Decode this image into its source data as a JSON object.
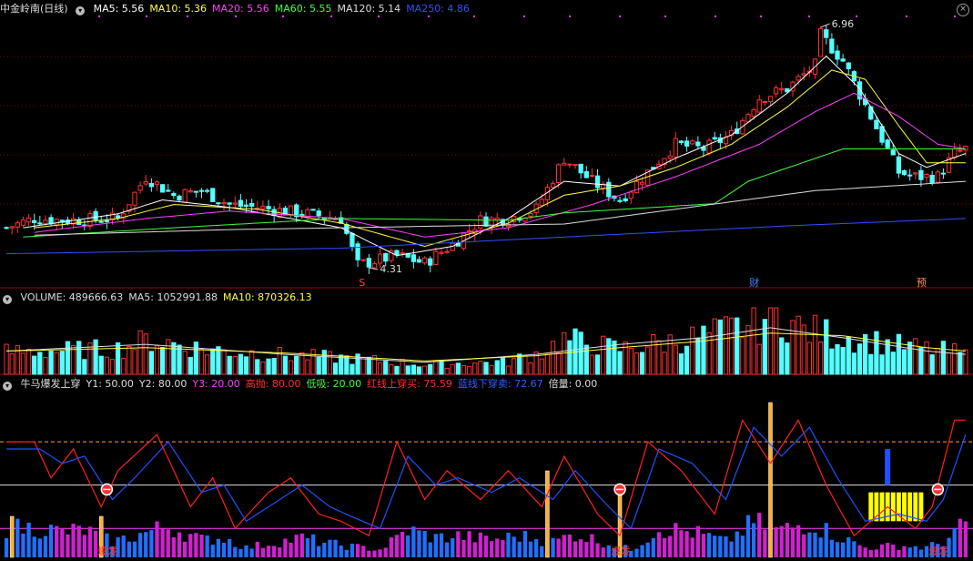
{
  "price_panel": {
    "stock_title": "中金岭南(日线)",
    "indicators": [
      {
        "label": "MA5: 5.56",
        "color": "#ffffff"
      },
      {
        "label": "MA10: 5.36",
        "color": "#ffff40"
      },
      {
        "label": "MA20: 5.56",
        "color": "#ff40ff"
      },
      {
        "label": "MA60: 5.55",
        "color": "#40ff40"
      },
      {
        "label": "MA120: 5.14",
        "color": "#dddddd"
      },
      {
        "label": "MA250: 4.86",
        "color": "#3050ff"
      }
    ],
    "high_label": "6.96",
    "low_label": "4.31",
    "markers": [
      {
        "label": "S",
        "color": "#ff4040"
      },
      {
        "label": "财",
        "color": "#4080ff"
      },
      {
        "label": "预",
        "color": "#ff9040"
      }
    ]
  },
  "volume_panel": {
    "indicators": [
      {
        "label": "VOLUME: 489666.63",
        "color": "#dddddd"
      },
      {
        "label": "MA5: 1052991.88",
        "color": "#dddddd"
      },
      {
        "label": "MA10: 870326.13",
        "color": "#ffff40"
      }
    ]
  },
  "osc_panel": {
    "indicators": [
      {
        "label": "牛马爆发上穿",
        "color": "#dddddd"
      },
      {
        "label": "Y1: 50.00",
        "color": "#dddddd"
      },
      {
        "label": "Y2: 80.00",
        "color": "#dddddd"
      },
      {
        "label": "Y3: 20.00",
        "color": "#ff40ff"
      },
      {
        "label": "高抛: 80.00",
        "color": "#ff3030"
      },
      {
        "label": "低吸: 20.00",
        "color": "#40ff40"
      },
      {
        "label": "红线上穿买: 75.59",
        "color": "#ff3030"
      },
      {
        "label": "蓝线下穿卖: 72.67",
        "color": "#3060ff"
      },
      {
        "label": "倍量: 0.00",
        "color": "#dddddd"
      }
    ],
    "burst_label": "爆发"
  },
  "colors": {
    "up": "#ff3030",
    "down": "#54ffff",
    "osc_red": "#ff2020",
    "osc_blue": "#2050ff",
    "bar_magenta": "#d020d0",
    "bar_blue": "#2070ff",
    "bar_orange": "#ffb030",
    "bar_yellow": "#ffff00"
  },
  "chart_data": [
    {
      "type": "candlestick",
      "n_days": 173,
      "ylim": [
        4.31,
        6.96
      ],
      "price_path": [
        [
          0,
          4.8
        ],
        [
          5,
          4.9
        ],
        [
          10,
          4.88
        ],
        [
          20,
          4.9
        ],
        [
          25,
          5.35
        ],
        [
          30,
          5.15
        ],
        [
          35,
          5.2
        ],
        [
          40,
          5.05
        ],
        [
          45,
          5.02
        ],
        [
          50,
          4.98
        ],
        [
          60,
          4.9
        ],
        [
          63,
          4.4
        ],
        [
          70,
          4.5
        ],
        [
          75,
          4.42
        ],
        [
          80,
          4.62
        ],
        [
          85,
          4.88
        ],
        [
          90,
          4.9
        ],
        [
          95,
          5.0
        ],
        [
          100,
          5.55
        ],
        [
          105,
          5.3
        ],
        [
          110,
          5.1
        ],
        [
          115,
          5.4
        ],
        [
          120,
          5.7
        ],
        [
          125,
          5.65
        ],
        [
          130,
          5.8
        ],
        [
          135,
          6.2
        ],
        [
          140,
          6.3
        ],
        [
          145,
          6.55
        ],
        [
          146,
          6.88
        ],
        [
          150,
          6.6
        ],
        [
          155,
          6.0
        ],
        [
          160,
          5.4
        ],
        [
          163,
          5.35
        ],
        [
          167,
          5.35
        ],
        [
          170,
          5.6
        ],
        [
          172,
          5.65
        ]
      ],
      "ma_paths": {
        "MA5": [
          [
            3,
            4.8
          ],
          [
            20,
            4.95
          ],
          [
            28,
            5.1
          ],
          [
            40,
            5.02
          ],
          [
            60,
            4.8
          ],
          [
            70,
            4.5
          ],
          [
            80,
            4.6
          ],
          [
            90,
            4.9
          ],
          [
            100,
            5.3
          ],
          [
            110,
            5.25
          ],
          [
            120,
            5.55
          ],
          [
            130,
            5.8
          ],
          [
            140,
            6.25
          ],
          [
            147,
            6.65
          ],
          [
            153,
            6.3
          ],
          [
            160,
            5.6
          ],
          [
            165,
            5.45
          ],
          [
            172,
            5.6
          ]
        ],
        "MA10": [
          [
            5,
            4.8
          ],
          [
            20,
            4.9
          ],
          [
            30,
            5.05
          ],
          [
            45,
            5.0
          ],
          [
            60,
            4.85
          ],
          [
            75,
            4.6
          ],
          [
            90,
            4.85
          ],
          [
            100,
            5.15
          ],
          [
            110,
            5.25
          ],
          [
            120,
            5.45
          ],
          [
            130,
            5.7
          ],
          [
            140,
            6.1
          ],
          [
            148,
            6.5
          ],
          [
            154,
            6.4
          ],
          [
            160,
            5.9
          ],
          [
            165,
            5.5
          ],
          [
            172,
            5.5
          ]
        ],
        "MA20": [
          [
            5,
            4.75
          ],
          [
            25,
            4.9
          ],
          [
            40,
            4.98
          ],
          [
            60,
            4.9
          ],
          [
            75,
            4.7
          ],
          [
            90,
            4.8
          ],
          [
            105,
            5.05
          ],
          [
            120,
            5.35
          ],
          [
            135,
            5.7
          ],
          [
            145,
            6.05
          ],
          [
            152,
            6.25
          ],
          [
            160,
            6.0
          ],
          [
            167,
            5.7
          ],
          [
            172,
            5.65
          ]
        ],
        "MA60": [
          [
            3,
            4.7
          ],
          [
            30,
            4.8
          ],
          [
            60,
            4.9
          ],
          [
            90,
            4.88
          ],
          [
            100,
            4.96
          ],
          [
            127,
            5.06
          ],
          [
            133,
            5.3
          ],
          [
            150,
            5.65
          ],
          [
            160,
            5.65
          ],
          [
            172,
            5.65
          ]
        ],
        "MA120": [
          [
            5,
            4.72
          ],
          [
            40,
            4.78
          ],
          [
            80,
            4.82
          ],
          [
            100,
            4.84
          ],
          [
            145,
            5.2
          ],
          [
            172,
            5.3
          ]
        ],
        "MA250": [
          [
            0,
            4.52
          ],
          [
            60,
            4.58
          ],
          [
            100,
            4.7
          ],
          [
            140,
            4.82
          ],
          [
            172,
            4.9
          ]
        ]
      }
    },
    {
      "type": "bar",
      "title": "VOLUME",
      "volume_path": [
        [
          0,
          0.35
        ],
        [
          20,
          0.4
        ],
        [
          26,
          0.55
        ],
        [
          35,
          0.4
        ],
        [
          50,
          0.3
        ],
        [
          62,
          0.25
        ],
        [
          75,
          0.15
        ],
        [
          90,
          0.2
        ],
        [
          96,
          0.35
        ],
        [
          100,
          0.55
        ],
        [
          110,
          0.4
        ],
        [
          118,
          0.5
        ],
        [
          125,
          0.6
        ],
        [
          132,
          0.75
        ],
        [
          135,
          0.8
        ],
        [
          137,
          1.0
        ],
        [
          143,
          0.7
        ],
        [
          150,
          0.6
        ],
        [
          160,
          0.45
        ],
        [
          170,
          0.35
        ],
        [
          172,
          0.3
        ]
      ],
      "ma5_path": [
        [
          0,
          0.35
        ],
        [
          25,
          0.45
        ],
        [
          50,
          0.3
        ],
        [
          75,
          0.18
        ],
        [
          95,
          0.3
        ],
        [
          110,
          0.45
        ],
        [
          125,
          0.55
        ],
        [
          137,
          0.7
        ],
        [
          150,
          0.55
        ],
        [
          165,
          0.35
        ],
        [
          172,
          0.3
        ]
      ],
      "ma10_path": [
        [
          0,
          0.35
        ],
        [
          25,
          0.4
        ],
        [
          50,
          0.32
        ],
        [
          75,
          0.2
        ],
        [
          95,
          0.28
        ],
        [
          110,
          0.4
        ],
        [
          125,
          0.5
        ],
        [
          137,
          0.62
        ],
        [
          150,
          0.58
        ],
        [
          165,
          0.4
        ],
        [
          172,
          0.35
        ]
      ]
    },
    {
      "type": "line",
      "title": "牛马爆发上穿",
      "ylim": [
        0,
        100
      ],
      "levels": [
        80,
        50,
        20
      ],
      "red_path": [
        [
          0,
          80
        ],
        [
          5,
          80
        ],
        [
          8,
          55
        ],
        [
          12,
          75
        ],
        [
          17,
          35
        ],
        [
          20,
          60
        ],
        [
          27,
          85
        ],
        [
          33,
          35
        ],
        [
          37,
          55
        ],
        [
          41,
          20
        ],
        [
          47,
          45
        ],
        [
          51,
          55
        ],
        [
          56,
          30
        ],
        [
          60,
          25
        ],
        [
          65,
          15
        ],
        [
          70,
          80
        ],
        [
          75,
          40
        ],
        [
          79,
          60
        ],
        [
          85,
          40
        ],
        [
          90,
          60
        ],
        [
          96,
          35
        ],
        [
          100,
          70
        ],
        [
          106,
          30
        ],
        [
          110,
          15
        ],
        [
          115,
          80
        ],
        [
          121,
          60
        ],
        [
          127,
          30
        ],
        [
          132,
          95
        ],
        [
          137,
          65
        ],
        [
          142,
          95
        ],
        [
          147,
          50
        ],
        [
          152,
          15
        ],
        [
          158,
          35
        ],
        [
          163,
          20
        ],
        [
          166,
          35
        ],
        [
          170,
          95
        ],
        [
          172,
          95
        ]
      ],
      "blue_path": [
        [
          0,
          75
        ],
        [
          6,
          75
        ],
        [
          10,
          65
        ],
        [
          14,
          70
        ],
        [
          19,
          40
        ],
        [
          23,
          55
        ],
        [
          29,
          80
        ],
        [
          35,
          45
        ],
        [
          39,
          50
        ],
        [
          43,
          25
        ],
        [
          49,
          40
        ],
        [
          53,
          50
        ],
        [
          58,
          35
        ],
        [
          62,
          28
        ],
        [
          67,
          20
        ],
        [
          72,
          70
        ],
        [
          77,
          50
        ],
        [
          81,
          55
        ],
        [
          87,
          45
        ],
        [
          92,
          55
        ],
        [
          98,
          40
        ],
        [
          102,
          60
        ],
        [
          108,
          35
        ],
        [
          112,
          20
        ],
        [
          117,
          75
        ],
        [
          123,
          65
        ],
        [
          129,
          40
        ],
        [
          134,
          90
        ],
        [
          139,
          70
        ],
        [
          144,
          90
        ],
        [
          149,
          55
        ],
        [
          154,
          25
        ],
        [
          160,
          30
        ],
        [
          165,
          25
        ],
        [
          168,
          40
        ],
        [
          172,
          85
        ]
      ],
      "burst_days": [
        18,
        110,
        167
      ],
      "burst_arrow_days": [
        18,
        110,
        167
      ]
    }
  ]
}
